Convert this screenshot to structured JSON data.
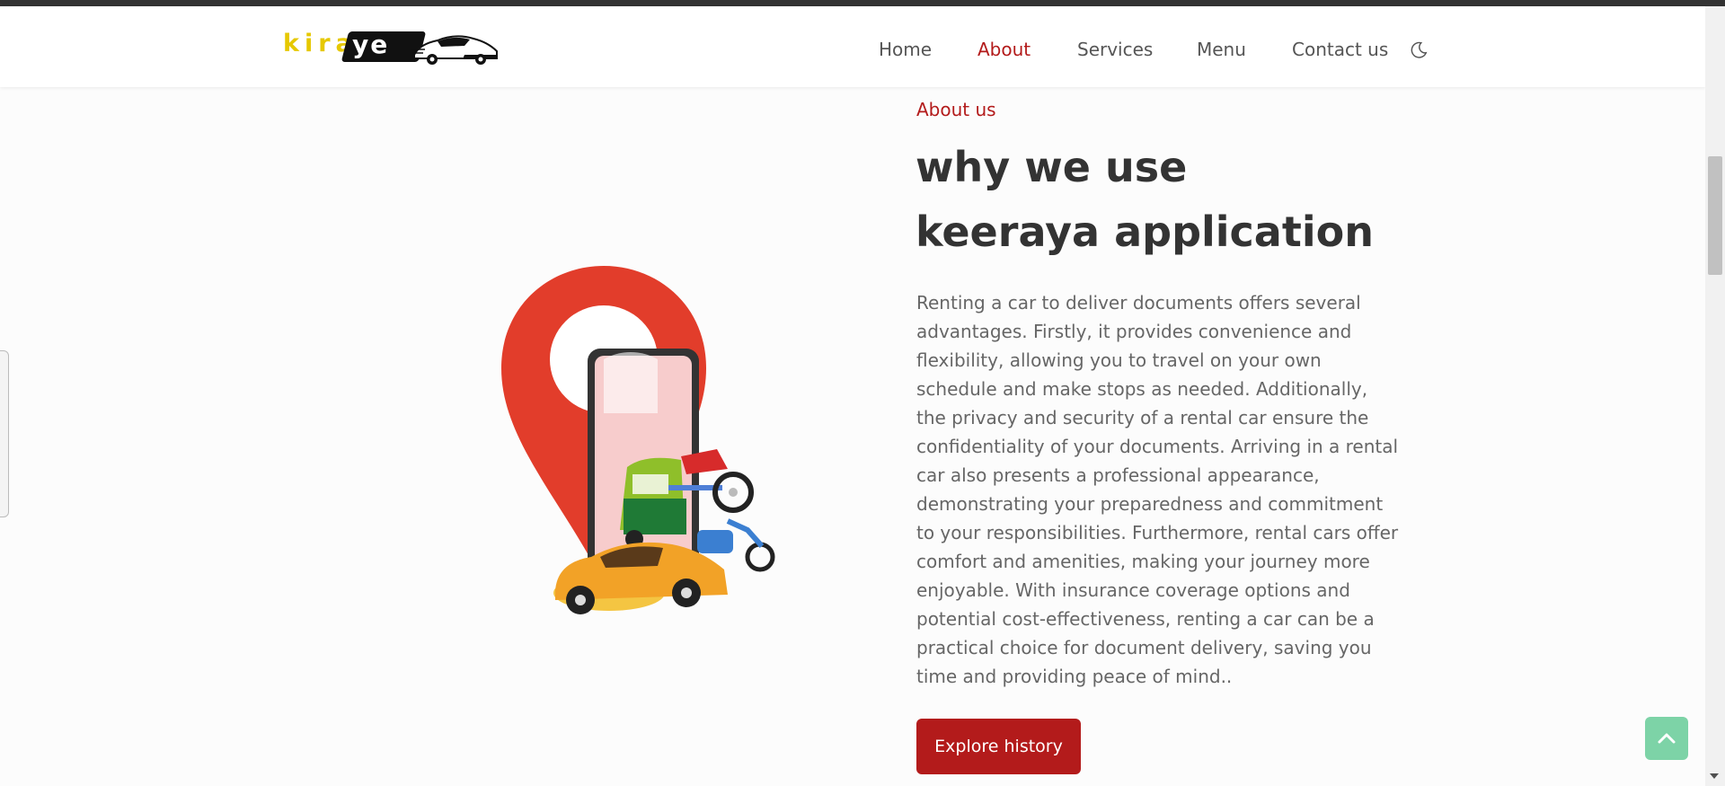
{
  "brand": {
    "logo_text": "kira",
    "logo_badge_text": "ye"
  },
  "nav": {
    "items": [
      {
        "label": "Home"
      },
      {
        "label": "About"
      },
      {
        "label": "Services"
      },
      {
        "label": "Menu"
      },
      {
        "label": "Contact us"
      }
    ],
    "active": "About",
    "theme_toggle_icon": "moon-icon"
  },
  "about": {
    "label": "About us",
    "heading_line1": "why we use",
    "heading_line2": "keeraya application",
    "body": "Renting a car to deliver documents offers several advantages. Firstly, it provides convenience and flexibility, allowing you to travel on your own schedule and make stops as needed. Additionally, the privacy and security of a rental car ensure the confidentiality of your documents. Arriving in a rental car also presents a professional appearance, demonstrating your preparedness and commitment to your responsibilities. Furthermore, rental cars offer comfort and amenities, making your journey more enjoyable. With insurance coverage options and potential cost-effectiveness, renting a car can be a practical choice for document delivery, saving you time and providing peace of mind..",
    "button_label": "Explore history"
  },
  "colors": {
    "accent": "#b31b1b",
    "logo_yellow": "#e6c800",
    "to_top_green": "#7dd3a7"
  },
  "icons": {
    "back_to_top": "chevron-up-icon"
  }
}
